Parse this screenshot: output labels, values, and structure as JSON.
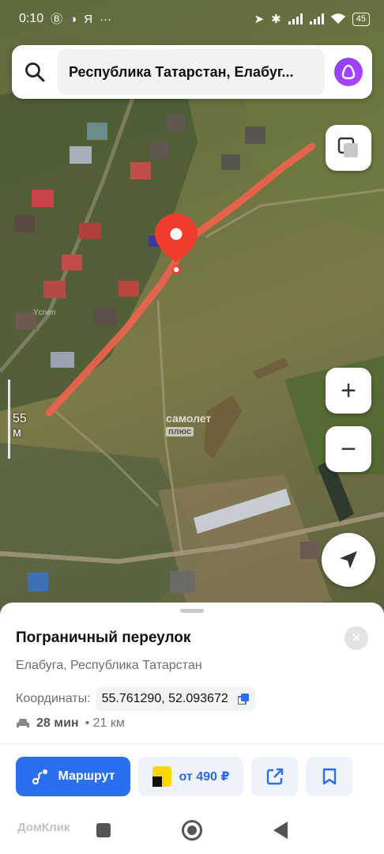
{
  "status_bar": {
    "time": "0:10",
    "left_icons": [
      "b-badge-icon",
      "dark-mode-icon",
      "yandex-icon",
      "more-dots-icon"
    ],
    "right_icons": [
      "location-arrow-icon",
      "bluetooth-icon",
      "signal-icon",
      "signal-icon",
      "wifi-icon"
    ],
    "battery": "45"
  },
  "search": {
    "query": "Республика Татарстан, Елабуг..."
  },
  "map": {
    "scale_label": "55 м",
    "watermark_main": "самолет",
    "watermark_sub": "плюс",
    "road_label": "Ycnen",
    "marker_color": "#f23d2e",
    "route_color": "#f0624f"
  },
  "controls": {
    "zoom_in": "+",
    "zoom_out": "−"
  },
  "place": {
    "title": "Пограничный переулок",
    "subtitle": "Елабуга, Республика Татарстан",
    "coords_label": "Координаты:",
    "coords_value": "55.761290, 52.093672",
    "eta_time": "28 мин",
    "eta_distance": "• 21 км"
  },
  "actions": {
    "route_label": "Маршрут",
    "taxi_label": "от 490 ₽"
  },
  "overlay": {
    "domklik": "ДомКлик"
  },
  "colors": {
    "accent": "#2a6ff0",
    "taxi_bg": "#eef2fb",
    "alice": "#9c44ff"
  }
}
